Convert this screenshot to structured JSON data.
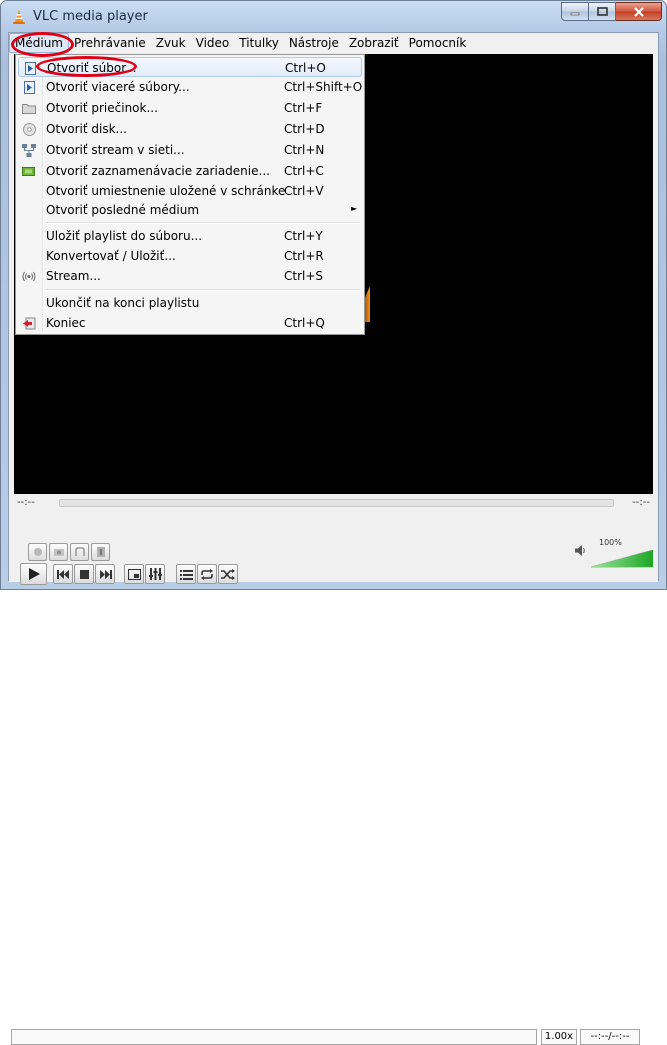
{
  "window": {
    "title": "VLC media player"
  },
  "menubar": {
    "items": [
      {
        "label": "Médium"
      },
      {
        "label": "Prehrávanie"
      },
      {
        "label": "Zvuk"
      },
      {
        "label": "Video"
      },
      {
        "label": "Titulky"
      },
      {
        "label": "Nástroje"
      },
      {
        "label": "Zobraziť"
      },
      {
        "label": "Pomocník"
      }
    ]
  },
  "media_menu": {
    "items": [
      {
        "label": "Otvoriť súbor...",
        "shortcut": "Ctrl+O",
        "icon": "open-file-icon"
      },
      {
        "label": "Otvoriť viaceré súbory...",
        "shortcut": "Ctrl+Shift+O",
        "icon": "open-files-icon"
      },
      {
        "label": "Otvoriť priečinok...",
        "shortcut": "Ctrl+F",
        "icon": "folder-icon"
      },
      {
        "label": "Otvoriť disk...",
        "shortcut": "Ctrl+D",
        "icon": "disc-icon"
      },
      {
        "label": "Otvoriť stream v sieti...",
        "shortcut": "Ctrl+N",
        "icon": "network-icon"
      },
      {
        "label": "Otvoriť zaznamenávacie zariadenie...",
        "shortcut": "Ctrl+C",
        "icon": "capture-device-icon"
      },
      {
        "label": "Otvoriť umiestnenie uložené v schránke",
        "shortcut": "Ctrl+V",
        "icon": ""
      },
      {
        "label": "Otvoriť posledné médium",
        "shortcut": "",
        "icon": ""
      },
      {
        "label": "Uložiť playlist do súboru...",
        "shortcut": "Ctrl+Y",
        "icon": ""
      },
      {
        "label": "Konvertovať / Uložiť...",
        "shortcut": "Ctrl+R",
        "icon": ""
      },
      {
        "label": "Stream...",
        "shortcut": "Ctrl+S",
        "icon": "stream-icon"
      },
      {
        "label": "Ukončiť na konci playlistu",
        "shortcut": "",
        "icon": ""
      },
      {
        "label": "Koniec",
        "shortcut": "Ctrl+Q",
        "icon": "exit-icon"
      }
    ]
  },
  "controls": {
    "time_elapsed": "--:--",
    "time_total": "--:--",
    "volume_percent": "100%",
    "volume_level": 1.0,
    "speed": "1.00x",
    "time_display": "--:--/--:--"
  },
  "colors": {
    "annotation": "#e00016",
    "video_bg": "#000000",
    "volume_green": "#2db832"
  }
}
